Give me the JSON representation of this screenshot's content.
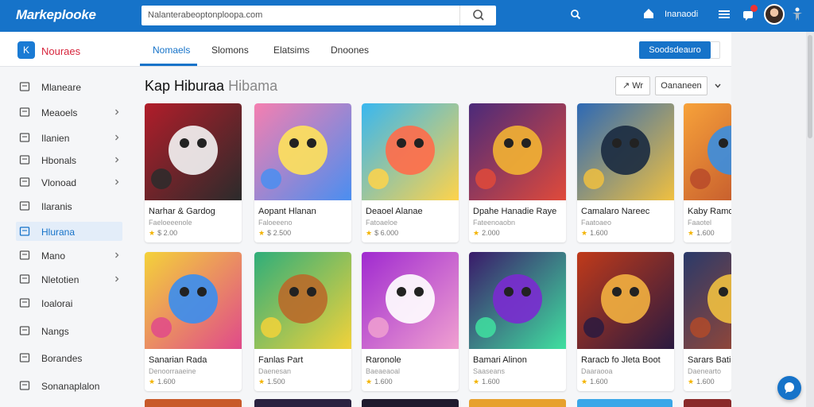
{
  "app": {
    "logo": "Markeplooke",
    "user_name": "Inanaodi"
  },
  "search": {
    "value": "Nalanterabeoptonploopa.com"
  },
  "section": {
    "badge": "K",
    "title": "Nouraes"
  },
  "tabs": [
    {
      "label": "Nomaels"
    },
    {
      "label": "Slomons"
    },
    {
      "label": "Elatsims"
    },
    {
      "label": "Dnoones"
    }
  ],
  "primary_button": "Soodsdeauro",
  "sidebar": {
    "items": [
      {
        "label": "Mlaneare",
        "icon": "building-icon",
        "chevron": false
      },
      {
        "label": "Meaoels",
        "icon": "briefcase-icon",
        "chevron": true
      },
      {
        "label": "Ilanien",
        "icon": "folder-icon",
        "chevron": true
      },
      {
        "label": "Hbonals",
        "icon": "grid-icon",
        "chevron": true
      },
      {
        "label": "Vlonoad",
        "icon": "inbox-icon",
        "chevron": true
      },
      {
        "label": "Ilaranis",
        "icon": "document-icon",
        "chevron": false
      },
      {
        "label": "Hlurana",
        "icon": "checkbox-icon",
        "chevron": false
      },
      {
        "label": "Mano",
        "icon": "mail-icon",
        "chevron": true
      },
      {
        "label": "Nletotien",
        "icon": "gear-icon",
        "chevron": true
      },
      {
        "label": "Ioalorai",
        "icon": "chart-icon",
        "chevron": false
      },
      {
        "label": "Nangs",
        "icon": "circle-icon",
        "chevron": false
      },
      {
        "label": "Borandes",
        "icon": "location-icon",
        "chevron": false
      },
      {
        "label": "Sonanaplalon",
        "icon": "cart-icon",
        "chevron": false
      }
    ]
  },
  "main": {
    "heading": "Kap Hiburaa",
    "heading_light": "Hibama",
    "sort_label": "↗ Wr",
    "select_value": "Oananeen"
  },
  "cards": [
    {
      "title": "Narhar & Gardog",
      "sub": "Faeloeeenole",
      "rating": "$ 2.00"
    },
    {
      "title": "Aopant Hlanan",
      "sub": "Faloeeeno",
      "rating": "$ 2.500"
    },
    {
      "title": "Deaoel Alanae",
      "sub": "Fatoaeloe",
      "rating": "$ 6.000"
    },
    {
      "title": "Dpahe Hanadie Raye",
      "sub": "Fateenoaobn",
      "rating": "2.000"
    },
    {
      "title": "Camalaro Nareec",
      "sub": "Faatoaeo",
      "rating": "1.600"
    },
    {
      "title": "Kaby Ramona",
      "sub": "Faaotel",
      "rating": "1.600"
    },
    {
      "title": "Sanarian Rada",
      "sub": "Denoorraaeine",
      "rating": "1.600"
    },
    {
      "title": "Fanlas Part",
      "sub": "Daenesan",
      "rating": "1.500"
    },
    {
      "title": "Raronole",
      "sub": "Baeaeaoal",
      "rating": "1.600"
    },
    {
      "title": "Bamari Alinon",
      "sub": "Saaseans",
      "rating": "1.600"
    },
    {
      "title": "Raracb fo Jleta Boot",
      "sub": "Daaraooa",
      "rating": "1.600"
    },
    {
      "title": "Sarars Batie",
      "sub": "Daenearto",
      "rating": "1.600"
    }
  ],
  "colors": {
    "brand": "#1673c9",
    "accent_red": "#d7263d",
    "star": "#f3b300"
  }
}
